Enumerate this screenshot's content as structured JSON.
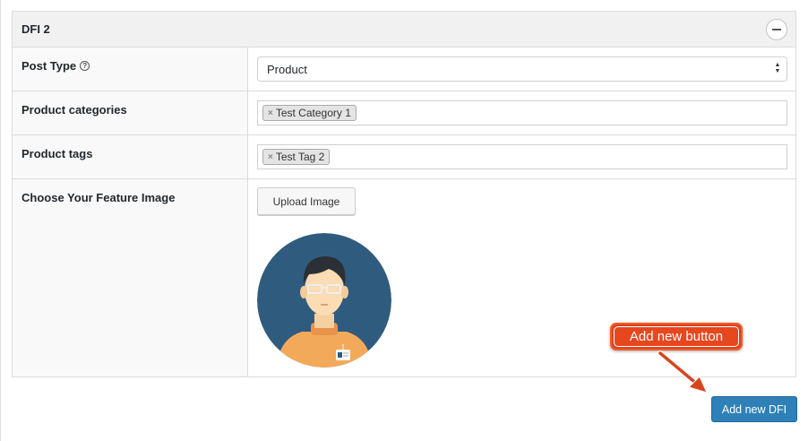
{
  "panel": {
    "title": "DFI 2",
    "collapse_icon": "minus-circle-icon"
  },
  "fields": {
    "post_type": {
      "label": "Post Type",
      "help_icon": "help-icon",
      "help_glyph": "?",
      "value": "Product"
    },
    "product_categories": {
      "label": "Product categories",
      "tags": [
        "Test Category 1"
      ],
      "remove_glyph": "×"
    },
    "product_tags": {
      "label": "Product tags",
      "tags": [
        "Test Tag 2"
      ],
      "remove_glyph": "×"
    },
    "feature_image": {
      "label": "Choose Your Feature Image",
      "upload_label": "Upload Image",
      "image": "avatar-illustration"
    }
  },
  "actions": {
    "add_new_label": "Add new DFI"
  },
  "annotation": {
    "callout_text": "Add new button"
  },
  "colors": {
    "primary_button": "#2e81b8",
    "callout": "#e6471f",
    "avatar_bg": "#2f5c7e",
    "shirt": "#f3a95a"
  }
}
